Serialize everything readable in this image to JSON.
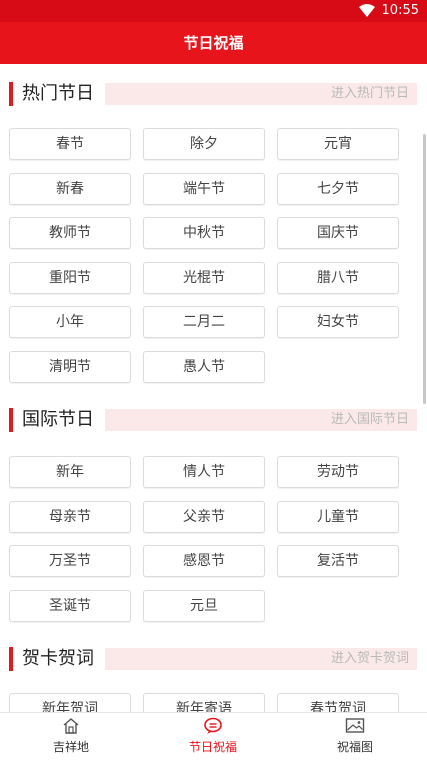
{
  "status_bar": {
    "time": "10:55",
    "wifi_icon": "wifi-icon"
  },
  "header": {
    "title": "节日祝福"
  },
  "sections": [
    {
      "title": "热门节日",
      "more": "进入热门节日",
      "items": [
        "春节",
        "除夕",
        "元宵",
        "新春",
        "端午节",
        "七夕节",
        "教师节",
        "中秋节",
        "国庆节",
        "重阳节",
        "光棍节",
        "腊八节",
        "小年",
        "二月二",
        "妇女节",
        "清明节",
        "愚人节"
      ]
    },
    {
      "title": "国际节日",
      "more": "进入国际节日",
      "items": [
        "新年",
        "情人节",
        "劳动节",
        "母亲节",
        "父亲节",
        "儿童节",
        "万圣节",
        "感恩节",
        "复活节",
        "圣诞节",
        "元旦"
      ]
    },
    {
      "title": "贺卡贺词",
      "more": "进入贺卡贺词",
      "items": [
        "新年贺词",
        "新年寄语",
        "春节贺词"
      ]
    }
  ],
  "bottom_nav": [
    {
      "label": "吉祥地",
      "icon": "house-icon",
      "active": false
    },
    {
      "label": "节日祝福",
      "icon": "chat-bubble-icon",
      "active": true
    },
    {
      "label": "祝福图",
      "icon": "picture-icon",
      "active": false
    }
  ],
  "colors": {
    "accent": "#e8141b",
    "status_bar": "#d70b15",
    "section_bar": "#d81e1e",
    "section_bg": "#fbe9e9"
  }
}
